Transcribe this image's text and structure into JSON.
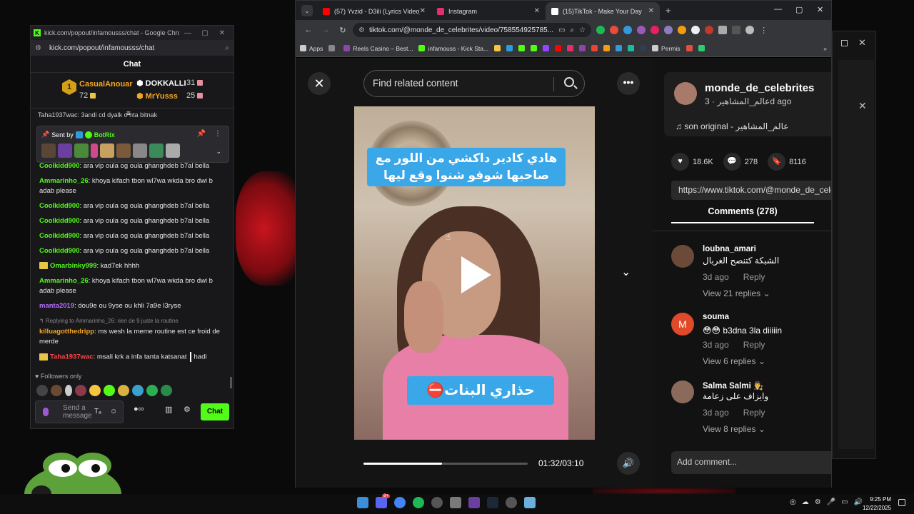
{
  "kick_window": {
    "title": "kick.com/popout/infamousss/chat - Google Chro...",
    "url": "kick.com/popout/infamousss/chat",
    "chat_header": "Chat",
    "leaderboard": [
      {
        "rank": "1",
        "name": "CasualAnouar",
        "count": "72",
        "color": "#f5a623"
      },
      {
        "name": "DOKKALLI",
        "count": "31",
        "color": "#ffffff"
      },
      {
        "name": "MrYusss",
        "count": "25",
        "color": "#f5a623"
      }
    ],
    "cut_line": "Taha1937wac: 3andi cd dyalk o nta bitnak",
    "pinned": {
      "label": "Sent by",
      "author": "BotRix"
    },
    "messages": [
      {
        "user": "Coolkidd900",
        "color": "#53fc18",
        "text": ": ara vip oula og oula ghanghdeb b7al bella"
      },
      {
        "user": "Ammarinho_26",
        "color": "#53fc18",
        "text": ": khoya kifach tbon wl7wa wkda bro dwi b adab please"
      },
      {
        "user": "Coolkidd900",
        "color": "#53fc18",
        "text": ": ara vip oula og oula ghanghdeb b7al bella"
      },
      {
        "user": "Coolkidd900",
        "color": "#53fc18",
        "text": ": ara vip oula og oula ghanghdeb b7al bella"
      },
      {
        "user": "Coolkidd900",
        "color": "#53fc18",
        "text": ": ara vip oula og oula ghanghdeb b7al bella"
      },
      {
        "user": "Coolkidd900",
        "color": "#53fc18",
        "text": ": ara vip oula og oula ghanghdeb b7al bella"
      },
      {
        "user": "Omarbinky999",
        "color": "#53fc18",
        "text": ": kad7ek hhhh"
      },
      {
        "user": "Ammarinho_26",
        "color": "#53fc18",
        "text": ": khoya kifach tbon wl7wa wkda bro dwi b adab please"
      },
      {
        "user": "manta2019",
        "color": "#b66dff",
        "text": ": dou9e ou 9yse ou khli 7a9e l3ryse"
      },
      {
        "reply": "Replying to Ammarinho_26: rien de 9 juste la routine",
        "user": "killuagotthedripp",
        "color": "#f5a623",
        "text": ": ms wesh la meme routine est ce froid de merde"
      },
      {
        "user": "Taha1937wac",
        "color": "#ff4444",
        "text": ": msali krk a infa tanta katsanat",
        "tail": "hadi"
      }
    ],
    "followers_only": "Followers only",
    "input_placeholder": "Send a message",
    "chat_button": "Chat"
  },
  "browser": {
    "tabs": [
      {
        "title": "(57) Yvzid - D3ili (Lyrics Video)",
        "favicon_color": "#ff0000"
      },
      {
        "title": "Instagram",
        "favicon_color": "#e1306c"
      },
      {
        "title": "(15)TikTok - Make Your Day",
        "favicon_color": "#ffffff"
      }
    ],
    "url": "tiktok.com/@monde_de_celebrites/video/758554925785...",
    "bookmarks": [
      {
        "label": "Apps",
        "color": "#cccccc"
      },
      {
        "label": "Reels Casino – Best...",
        "color": "#8e44ad"
      },
      {
        "label": "infamouss - Kick Sta...",
        "color": "#53fc18"
      },
      {
        "label": "Permis",
        "color": "#cccccc"
      }
    ]
  },
  "tiktok": {
    "search_placeholder": "Find related content",
    "caption_top": "هادي كادير داكشي من اللور مع صاحبها شوفو شنوا وقع ليها",
    "caption_bottom": "حذاري البنات⛔",
    "progress": 0.48,
    "time": "01:32/03:10",
    "author": {
      "name": "monde_de_celebrites",
      "sub": "عالم_المشاهير · 3d ago"
    },
    "sound": "son original - عالم_المشاهير",
    "stats": {
      "likes": "18.6K",
      "comments": "278",
      "saves": "8116"
    },
    "link": "https://www.tiktok.com/@monde_de_celebrites",
    "comments_tab": "Comments (278)",
    "comments": [
      {
        "name": "loubna_amari",
        "text": "الشبكة كتنصح الغربال",
        "meta_time": "3d ago",
        "meta_reply": "Reply",
        "replies": "View 21 replies",
        "avatar_color": "#6b4a3a"
      },
      {
        "name": "souma",
        "text": "😳😳 b3dna 3la diiiiin",
        "meta_time": "3d ago",
        "meta_reply": "Reply",
        "replies": "View 6 replies",
        "avatar_color": "#e04a2a",
        "avatar_letter": "M"
      },
      {
        "name": "Salma Salmi 👨‍⚖️",
        "text": "وايزاف على زعامة",
        "meta_time": "3d ago",
        "meta_reply": "Reply",
        "replies": "View 8 replies",
        "avatar_color": "#8a6a5a"
      }
    ],
    "add_comment": "Add comment..."
  },
  "taskbar": {
    "time": "9:25 PM",
    "date": "12/22/2025"
  }
}
